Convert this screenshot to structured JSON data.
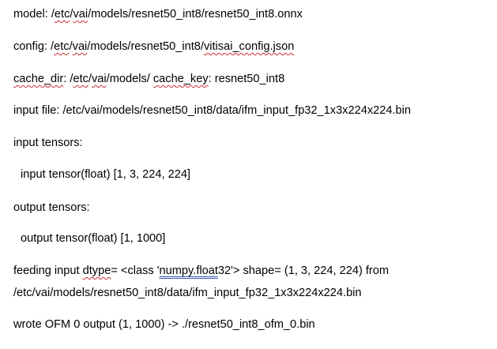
{
  "lines": {
    "model": {
      "prefix": "model: /",
      "seg1": "etc",
      "sep1": "/",
      "seg2": "vai",
      "rest": "/models/resnet50_int8/resnet50_int8.onnx"
    },
    "config": {
      "prefix": "config: /",
      "seg1": "etc",
      "sep1": "/",
      "seg2": "vai",
      "mid": "/models/resnet50_int8/",
      "seg3": "vitisai_config.json"
    },
    "cache": {
      "seg1": "cache_dir",
      "part1": ": /",
      "seg2": "etc",
      "sep1": "/",
      "seg3": "vai",
      "part2": "/models/ ",
      "seg4": "cache_key",
      "rest": ": resnet50_int8"
    },
    "input_file": "input file: /etc/vai/models/resnet50_int8/data/ifm_input_fp32_1x3x224x224.bin",
    "input_tensors_label": "input tensors:",
    "input_tensor": "input tensor(float) [1, 3, 224, 224]",
    "output_tensors_label": "output tensors:",
    "output_tensor": "output tensor(float) [1, 1000]",
    "feeding": {
      "prefix": "feeding input ",
      "seg1": "dtype",
      "mid": "= <class '",
      "seg2": "numpy.float",
      "rest": "32'> shape= (1, 3, 224, 224) from"
    },
    "feeding_path": "/etc/vai/models/resnet50_int8/data/ifm_input_fp32_1x3x224x224.bin",
    "wrote": "wrote OFM 0 output (1, 1000) -> ./resnet50_int8_ofm_0.bin"
  },
  "colors": {
    "text": "#000000",
    "spell_squiggle": "#d03030",
    "grammar_underline": "#3b5fb0"
  }
}
